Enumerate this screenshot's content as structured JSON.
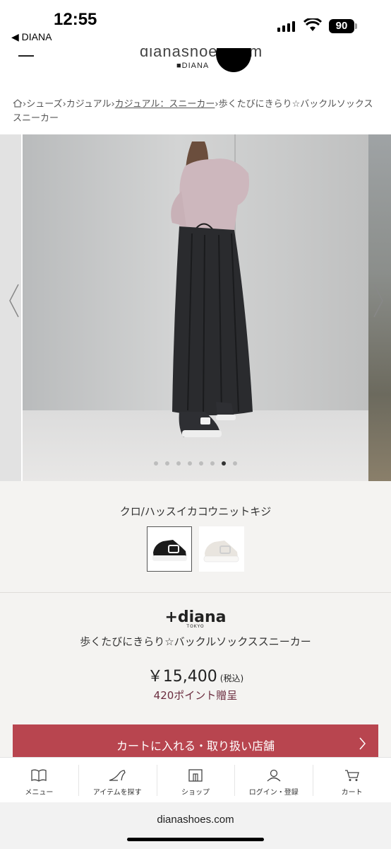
{
  "status_bar": {
    "time": "12:55",
    "back_label": "◀ DIANA",
    "battery": "90"
  },
  "header": {
    "logo_text": "dianashoes.com",
    "logo_sub": "DIANA"
  },
  "breadcrumb": {
    "items": [
      "シューズ",
      "カジュアル",
      "カジュアル：スニーカー",
      "歩くたびにきらり☆バックルソックススニーカー"
    ],
    "separator": "›"
  },
  "carousel": {
    "dot_count": 8,
    "active_dot": 6
  },
  "colors": {
    "selected_name": "クロ/ハッスイカコウニットキジ",
    "swatches": [
      "black",
      "white"
    ]
  },
  "product": {
    "brand": "+diana",
    "brand_sub": "TOKYO",
    "name": "歩くたびにきらり☆バックルソックススニーカー",
    "price": "￥15,400",
    "tax_label": "(税込)",
    "points": "420ポイント贈呈",
    "cart_button": "カートに入れる・取り扱い店舗"
  },
  "tabbar": {
    "items": [
      {
        "label": "メニュー",
        "icon": "book-icon"
      },
      {
        "label": "アイテムを探す",
        "icon": "heel-icon"
      },
      {
        "label": "ショップ",
        "icon": "shop-icon"
      },
      {
        "label": "ログイン・登録",
        "icon": "user-icon"
      },
      {
        "label": "カート",
        "icon": "cart-icon"
      }
    ]
  },
  "browser": {
    "url": "dianashoes.com"
  },
  "colors_theme": {
    "accent": "#b8454f",
    "points": "#6b2d3f",
    "background": "#f4f3f1"
  }
}
